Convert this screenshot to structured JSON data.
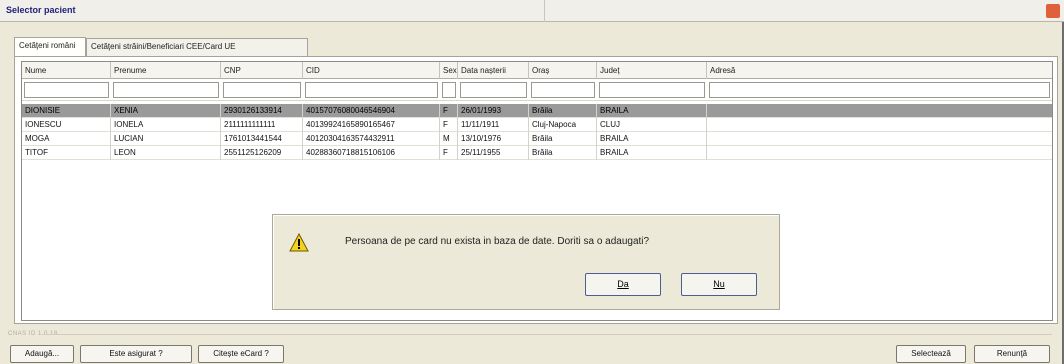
{
  "window": {
    "title": "Selector pacient"
  },
  "tabs": [
    {
      "label": "Cetăţeni români"
    },
    {
      "label": "Cetăţeni străini/Beneficiari CEE/Card UE"
    }
  ],
  "table": {
    "columns": [
      "Nume",
      "Prenume",
      "CNP",
      "CID",
      "Sex",
      "Data nașterii",
      "Oraș",
      "Județ",
      "Adresă"
    ],
    "rows": [
      {
        "nume": "DIONISIE",
        "prenume": "XENIA",
        "cnp": "2930126133914",
        "cid": "40157076080046546904",
        "sex": "F",
        "data": "26/01/1993",
        "oras": "Brăila",
        "judet": "BRAILA",
        "adresa": ""
      },
      {
        "nume": "IONESCU",
        "prenume": "IONELA",
        "cnp": "2111111111111",
        "cid": "40139924165890165467",
        "sex": "F",
        "data": "11/11/1911",
        "oras": "Cluj-Napoca",
        "judet": "CLUJ",
        "adresa": ""
      },
      {
        "nume": "MOGA",
        "prenume": "LUCIAN",
        "cnp": "1761013441544",
        "cid": "40120304163574432911",
        "sex": "M",
        "data": "13/10/1976",
        "oras": "Brăila",
        "judet": "BRAILA",
        "adresa": ""
      },
      {
        "nume": "TITOF",
        "prenume": "LEON",
        "cnp": "2551125126209",
        "cid": "40288360718815106106",
        "sex": "F",
        "data": "25/11/1955",
        "oras": "Brăila",
        "judet": "BRAILA",
        "adresa": ""
      }
    ],
    "selected_row": 0
  },
  "dialog": {
    "message": "Persoana de pe card nu exista in baza de date. Doriti sa o adaugati?",
    "yes_label": "Da",
    "no_label": "Nu",
    "icon": "warning-icon"
  },
  "status_strip": "CNAS ID 1.0.18",
  "buttons": {
    "add": "Adaugă...",
    "insured": "Este asigurat ?",
    "read_card": "Citește eCard ?",
    "select": "Selectează",
    "cancel": "Renunţă"
  },
  "colors": {
    "selected_row": "#9a9a9a",
    "warning_yellow": "#f5d11f",
    "window_bg": "#ece9d8"
  }
}
